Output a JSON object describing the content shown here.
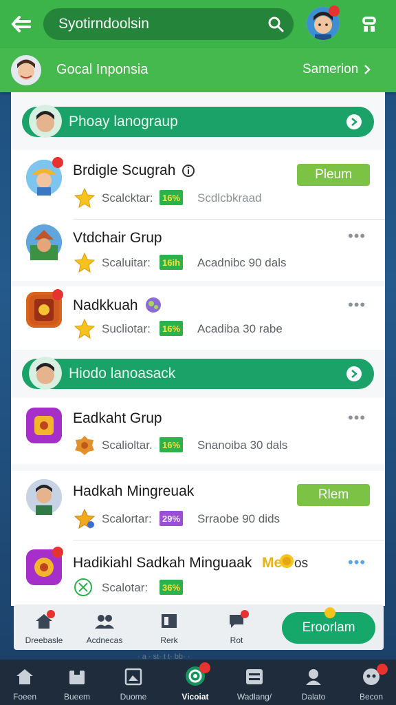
{
  "header": {
    "search_text": "Syotirndoolsin",
    "group_label": "Gocal Inponsia",
    "group_action": "Samerion"
  },
  "sections": [
    {
      "label": "Phoay lanograup"
    },
    {
      "label": "Hiodo lanoasack"
    }
  ],
  "rows": [
    {
      "title": "Brdigle Scugrah",
      "sub_label": "Scalcktar:",
      "tag": "16%",
      "tag_color": "#2bb24c",
      "detail": "Scdlcbkraad",
      "action": "Pleum"
    },
    {
      "title": "Vtdchair Grup",
      "sub_label": "Scaluitar:",
      "tag": "16ih",
      "tag_color": "#2bb24c",
      "detail": "Acadnibc 90 dals"
    },
    {
      "title": "Nadkkuah",
      "sub_label": "Sucliotar:",
      "tag": "16%",
      "tag_color": "#2bb24c",
      "detail": "Acadiba 30 rabe"
    },
    {
      "title": "Eadkaht Grup",
      "sub_label": "Scalioltar.",
      "tag": "16%",
      "tag_color": "#2bb24c",
      "detail": "Snanoiba 30 dals"
    },
    {
      "title": "Hadkah Mingreuak",
      "sub_label": "Scalortar:",
      "tag": "29%",
      "tag_color": "#9b4fd6",
      "detail": "Srraobe 90 dids",
      "action": "Rlem"
    },
    {
      "title": "Hadikiahl Sadkah Minguaak",
      "title_extra": "Me",
      "title_suffix": "os",
      "sub_label": "Scalotar:",
      "tag": "36%",
      "tag_color": "#2bb24c"
    }
  ],
  "inner_nav": [
    {
      "label": "Dreebasle",
      "icon": "home-icon"
    },
    {
      "label": "Acdnecas",
      "icon": "people-icon"
    },
    {
      "label": "Rerk",
      "icon": "tag-icon"
    },
    {
      "label": "Rot",
      "icon": "chat-icon"
    }
  ],
  "cta_label": "Eroorlam",
  "caption": "· a · st· t t· bb· ·",
  "bottom_nav": [
    {
      "label": "Foeen",
      "icon": "home-icon"
    },
    {
      "label": "Bueem",
      "icon": "folder-icon"
    },
    {
      "label": "Duome",
      "icon": "gallery-icon"
    },
    {
      "label": "Vicoiat",
      "icon": "target-icon",
      "active": true
    },
    {
      "label": "Wadlang/",
      "icon": "list-icon"
    },
    {
      "label": "Dalato",
      "icon": "person-icon"
    },
    {
      "label": "Becon",
      "icon": "user-icon"
    }
  ],
  "colors": {
    "brand_green": "#3cb44a",
    "section_green": "#1aa268",
    "badge_red": "#e8322f"
  }
}
